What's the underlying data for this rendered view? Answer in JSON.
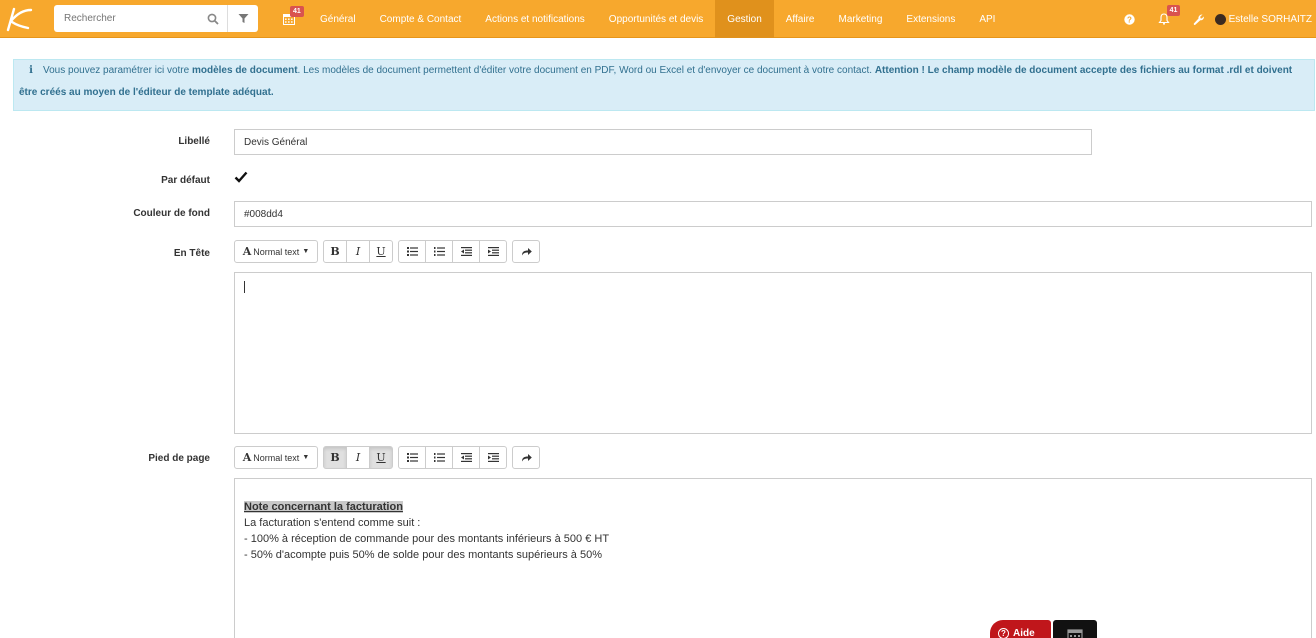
{
  "colors": {
    "topbar": "#f7a82d",
    "topbar_active": "#e0911c",
    "alert_bg": "#d9edf7",
    "alert_text": "#31708f",
    "badge": "#d9534f",
    "aide": "#c0161b"
  },
  "search": {
    "placeholder": "Rechercher"
  },
  "nav": {
    "calendar_badge": "41",
    "items": [
      {
        "label": "Général"
      },
      {
        "label": "Compte & Contact"
      },
      {
        "label": "Actions et notifications"
      },
      {
        "label": "Opportunités et devis"
      },
      {
        "label": "Gestion",
        "active": true
      },
      {
        "label": "Affaire"
      },
      {
        "label": "Marketing"
      },
      {
        "label": "Extensions"
      },
      {
        "label": "API"
      }
    ]
  },
  "right": {
    "notif_badge": "41",
    "user_name": "Estelle SORHAITZ"
  },
  "alert": {
    "icon": "i",
    "p1": "Vous pouvez paramétrer ici votre ",
    "b1": "modèles de document",
    "p2": ". Les modèles de document permettent d'éditer votre document en PDF, Word ou Excel et d'envoyer ce document à votre contact. ",
    "b2": "Attention ! Le champ modèle de document accepte des fichiers au format .rdl et doivent être créés au moyen de l'éditeur de template adéquat."
  },
  "form": {
    "libelle_label": "Libellé",
    "libelle_value": "Devis Général",
    "par_defaut_label": "Par défaut",
    "par_defaut_checked": true,
    "couleur_label": "Couleur de fond",
    "couleur_value": "#008dd4",
    "entete_label": "En Tête",
    "pied_label": "Pied de page"
  },
  "toolbar": {
    "format_label": "Normal text",
    "format_icon": "A",
    "bold": "B",
    "italic": "I",
    "underline": "U"
  },
  "footer_text": {
    "title": "Note concernant la facturation",
    "l1": "La facturation s'entend comme suit :",
    "l2": "- 100% à réception de commande pour des montants inférieurs à 500 € HT",
    "l3": "- 50% d'acompte puis 50% de solde pour des montants supérieurs à 50%"
  },
  "aide": {
    "label": "Aide",
    "icon": "?"
  }
}
